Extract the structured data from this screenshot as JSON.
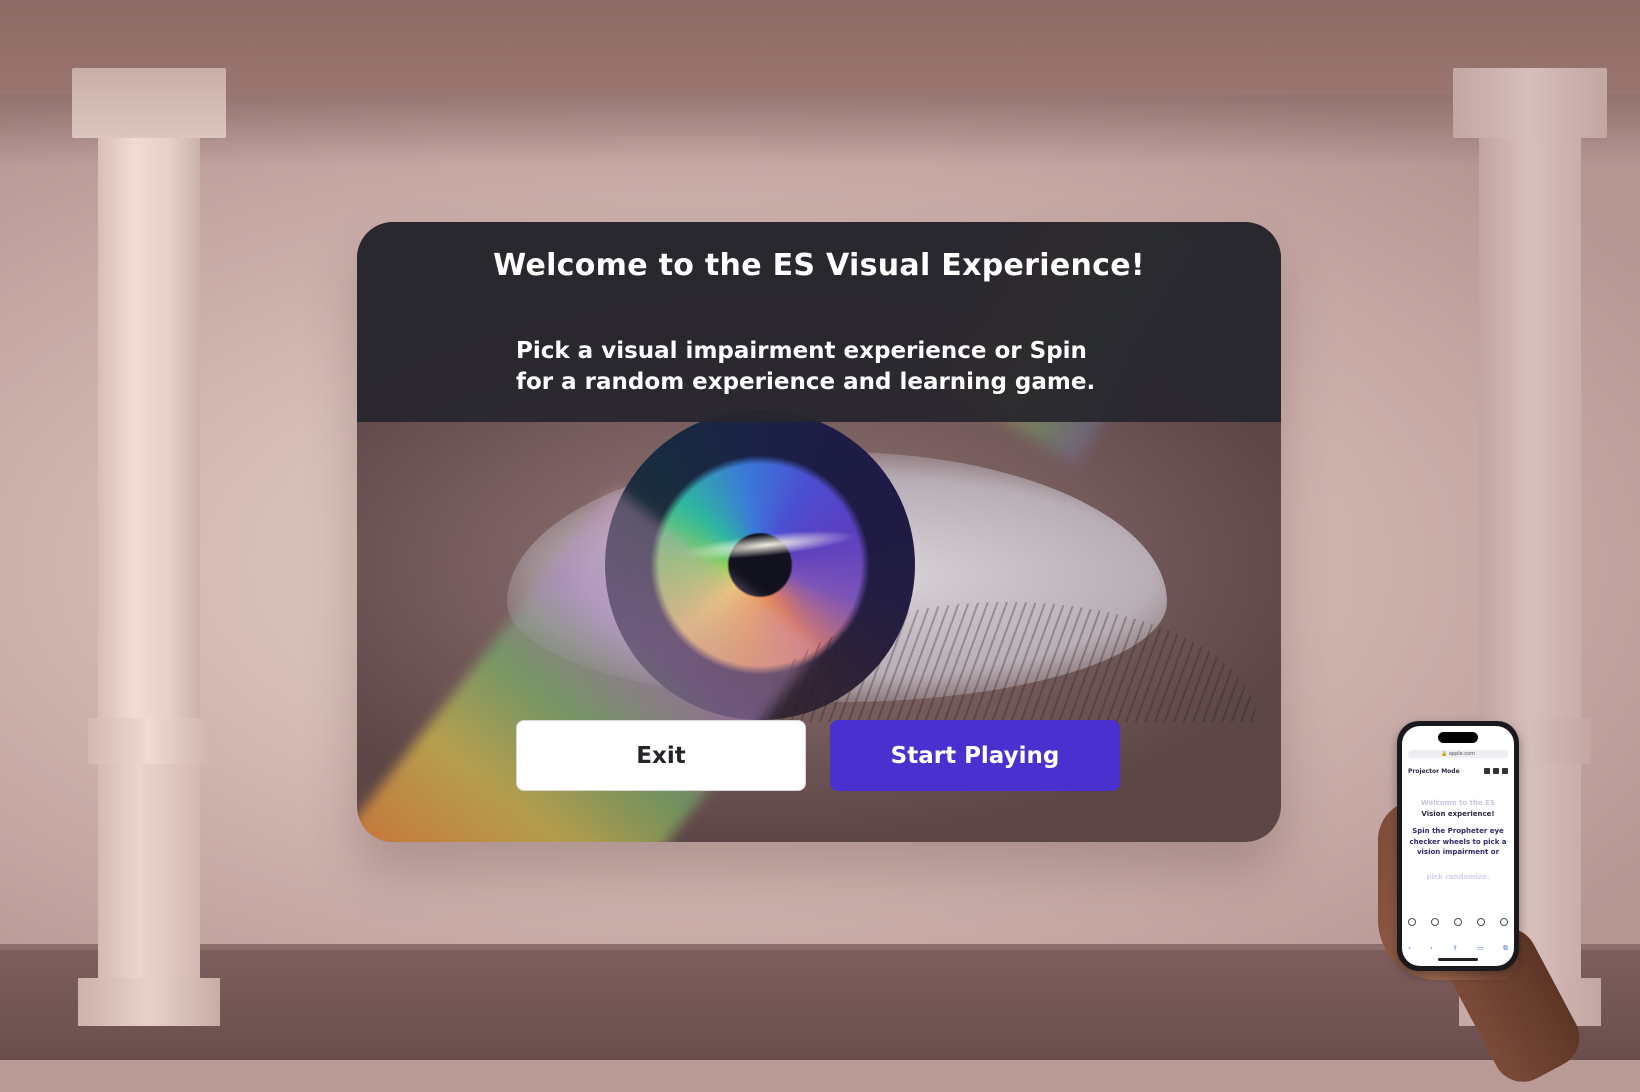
{
  "panel": {
    "title": "Welcome to the ES Visual Experience!",
    "subtitle": "Pick a visual impairment experience or Spin for a random experience and learning game.",
    "buttons": {
      "exit_label": "Exit",
      "start_label": "Start Playing"
    }
  },
  "phone": {
    "url": "🔒 apple.com",
    "header_label": "Projector Mode",
    "faded_heading": "Welcome to the ES",
    "heading": "Vision experience!",
    "body": "Spin the Propheter eye checker wheels to pick a vision impairment or",
    "body_faded": "pick randomize.",
    "controls": [
      "home-icon",
      "speaker-icon",
      "close-icon",
      "clock-icon",
      "help-icon"
    ],
    "nav": [
      "‹",
      "›",
      "⇪",
      "▭",
      "⧉"
    ]
  },
  "colors": {
    "primary": "#4a31cf",
    "header_bg": "#26262c",
    "text_light": "#ffffff"
  }
}
